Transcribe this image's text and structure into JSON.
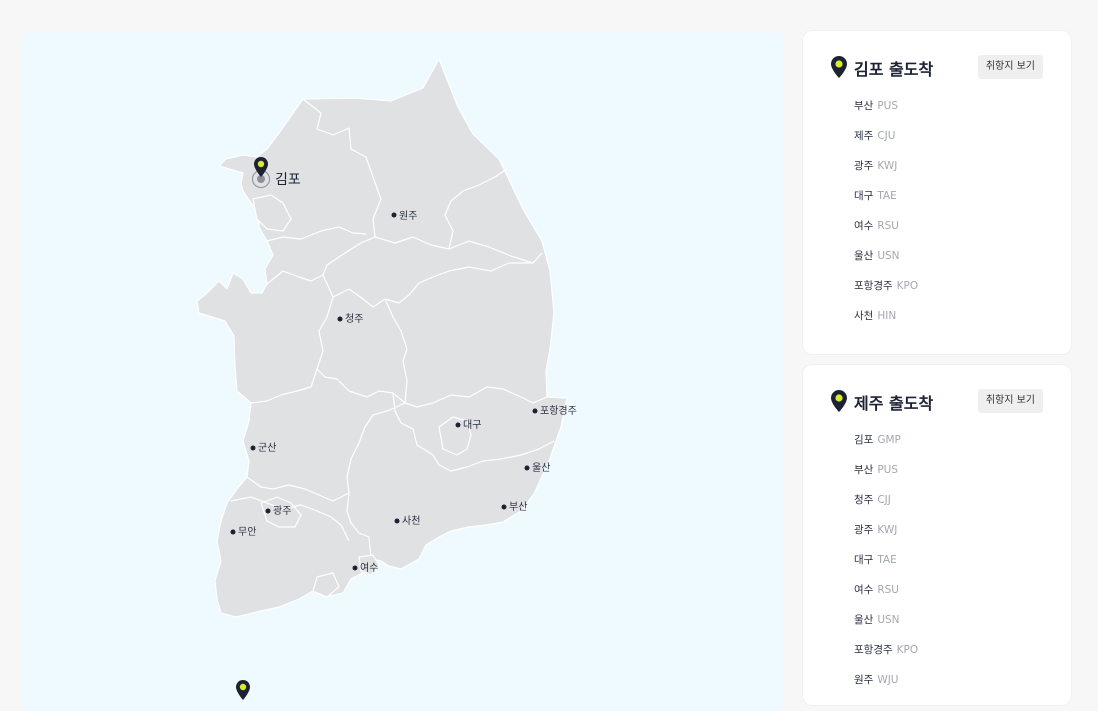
{
  "map": {
    "hub_label": "김포",
    "cities": [
      {
        "key": "wonju",
        "name": "원주"
      },
      {
        "key": "cheongju",
        "name": "청주"
      },
      {
        "key": "pohang",
        "name": "포항경주"
      },
      {
        "key": "daegu",
        "name": "대구"
      },
      {
        "key": "gunsan",
        "name": "군산"
      },
      {
        "key": "ulsan",
        "name": "울산"
      },
      {
        "key": "gwangju",
        "name": "광주"
      },
      {
        "key": "busan",
        "name": "부산"
      },
      {
        "key": "sacheon",
        "name": "사천"
      },
      {
        "key": "muan",
        "name": "무안"
      },
      {
        "key": "yeosu",
        "name": "여수"
      }
    ]
  },
  "cards": [
    {
      "title": "김포 출도착",
      "button": "취항지 보기",
      "destinations": [
        {
          "name": "부산",
          "code": "PUS"
        },
        {
          "name": "제주",
          "code": "CJU"
        },
        {
          "name": "광주",
          "code": "KWJ"
        },
        {
          "name": "대구",
          "code": "TAE"
        },
        {
          "name": "여수",
          "code": "RSU"
        },
        {
          "name": "울산",
          "code": "USN"
        },
        {
          "name": "포항경주",
          "code": "KPO"
        },
        {
          "name": "사천",
          "code": "HIN"
        }
      ]
    },
    {
      "title": "제주 출도착",
      "button": "취항지 보기",
      "destinations": [
        {
          "name": "김포",
          "code": "GMP"
        },
        {
          "name": "부산",
          "code": "PUS"
        },
        {
          "name": "청주",
          "code": "CJJ"
        },
        {
          "name": "광주",
          "code": "KWJ"
        },
        {
          "name": "대구",
          "code": "TAE"
        },
        {
          "name": "여수",
          "code": "RSU"
        },
        {
          "name": "울산",
          "code": "USN"
        },
        {
          "name": "포항경주",
          "code": "KPO"
        },
        {
          "name": "원주",
          "code": "WJU"
        }
      ]
    }
  ],
  "colors": {
    "map_background": "#eefaff",
    "land": "#e0e1e3",
    "pin": "#1c2233",
    "pin_dot": "#d8ec2c",
    "city_dot": "#1c2233"
  },
  "icons": {
    "hub": "map-pin-icon",
    "city": "dot-icon"
  }
}
